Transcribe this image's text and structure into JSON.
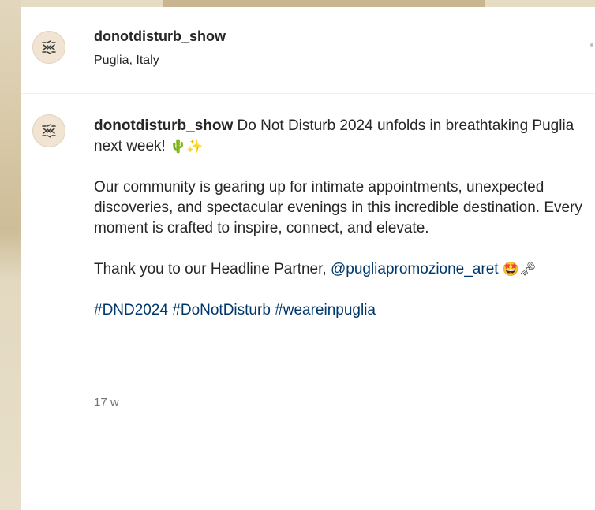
{
  "post": {
    "username": "donotdisturb_show",
    "location": "Puglia, Italy",
    "caption": {
      "intro": "Do Not Disturb 2024 unfolds in breathtaking Puglia next week!",
      "intro_emojis": "🌵✨",
      "paragraph2": "Our community is gearing up for intimate appointments, unexpected discoveries, and spectacular evenings in this incredible destination. Every moment is crafted to inspire, connect, and elevate.",
      "paragraph3_text": "Thank you to our Headline Partner,",
      "partner_mention": "@pugliapromozione_aret",
      "paragraph3_emojis": "🤩🗝",
      "hashtags": [
        "#DND2024",
        "#DoNotDisturb",
        "#weareinpuglia"
      ]
    },
    "timestamp": "17 w"
  },
  "icons": {
    "avatar": "donotdisturb-logo-icon"
  },
  "colors": {
    "link": "#00376b",
    "text": "#262626",
    "muted": "#737373",
    "avatar_bg": "#f1e4d3"
  }
}
